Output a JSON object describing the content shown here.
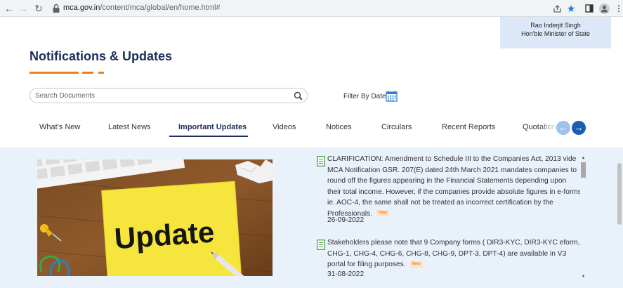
{
  "browser": {
    "url_host": "mca.gov.in",
    "url_path": "/content/mca/global/en/home.html#"
  },
  "minister": {
    "name": "Rao Inderjit Singh",
    "role": "Hon'ble Minister of State"
  },
  "section": {
    "title": "Notifications & Updates"
  },
  "search": {
    "placeholder": "Search Documents",
    "filter_label": "Filter By Date"
  },
  "tabs": [
    {
      "label": "What's New"
    },
    {
      "label": "Latest News"
    },
    {
      "label": "Important Updates",
      "active": true
    },
    {
      "label": "Videos"
    },
    {
      "label": "Notices"
    },
    {
      "label": "Circulars"
    },
    {
      "label": "Recent Reports"
    },
    {
      "label": "Quotation"
    }
  ],
  "image": {
    "note_text": "Update"
  },
  "updates": [
    {
      "text": "CLARIFICATION: Amendment to Schedule III to the Companies Act, 2013 vide MCA Notification GSR. 207(E) dated 24th March 2021 mandates companies to round off the figures appearing in the Financial Statements depending upon their total income. However, if the companies provide absolute figures in e-forms ie. AOC-4, the same shall not be treated as incorrect certification by the Professionals.",
      "badge": "New",
      "date": "26-09-2022"
    },
    {
      "text": "Stakeholders please note that 9 Company forms ( DIR3-KYC, DIR3-KYC eform, CHG-1, CHG-4, CHG-6, CHG-8, CHG-9, DPT-3, DPT-4) are available in V3 portal for filing purposes.",
      "badge": "New",
      "date": "31-08-2022"
    }
  ],
  "colors": {
    "title": "#1b2f5b",
    "accent": "#f07f1a",
    "panel_bg": "#e9f1fa",
    "arrow_active": "#1a5fb4",
    "arrow_inactive": "#9ec2ea",
    "doc_icon": "#3a9b3a"
  },
  "icons": [
    "back-arrow-icon",
    "forward-arrow-icon",
    "reload-icon",
    "lock-icon",
    "share-icon",
    "star-icon",
    "sidebar-icon",
    "profile-icon",
    "menu-icon",
    "search-icon",
    "calendar-icon",
    "arrow-left-icon",
    "arrow-right-icon",
    "document-icon"
  ]
}
